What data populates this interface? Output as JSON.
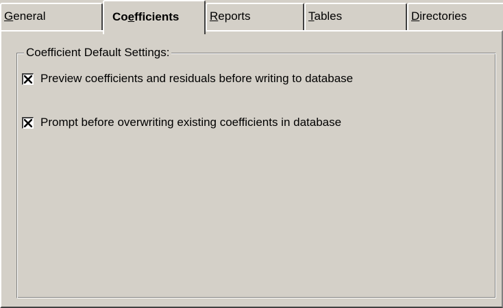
{
  "tabs": {
    "general": {
      "first": "G",
      "rest": "eneral"
    },
    "coefficients": {
      "before": "Co",
      "key": "e",
      "after": "fficients"
    },
    "reports": {
      "first": "R",
      "rest": "eports"
    },
    "tables": {
      "first": "T",
      "rest": "ables"
    },
    "directories": {
      "first": "D",
      "rest": "irectories"
    }
  },
  "group": {
    "title": "Coefficient Default Settings:"
  },
  "options": [
    {
      "label": "Preview coefficients and residuals before writing to database",
      "checked": true
    },
    {
      "label": "Prompt before overwriting existing coefficients in database",
      "checked": true
    }
  ],
  "icons": {
    "checkbox": "check-icon"
  }
}
